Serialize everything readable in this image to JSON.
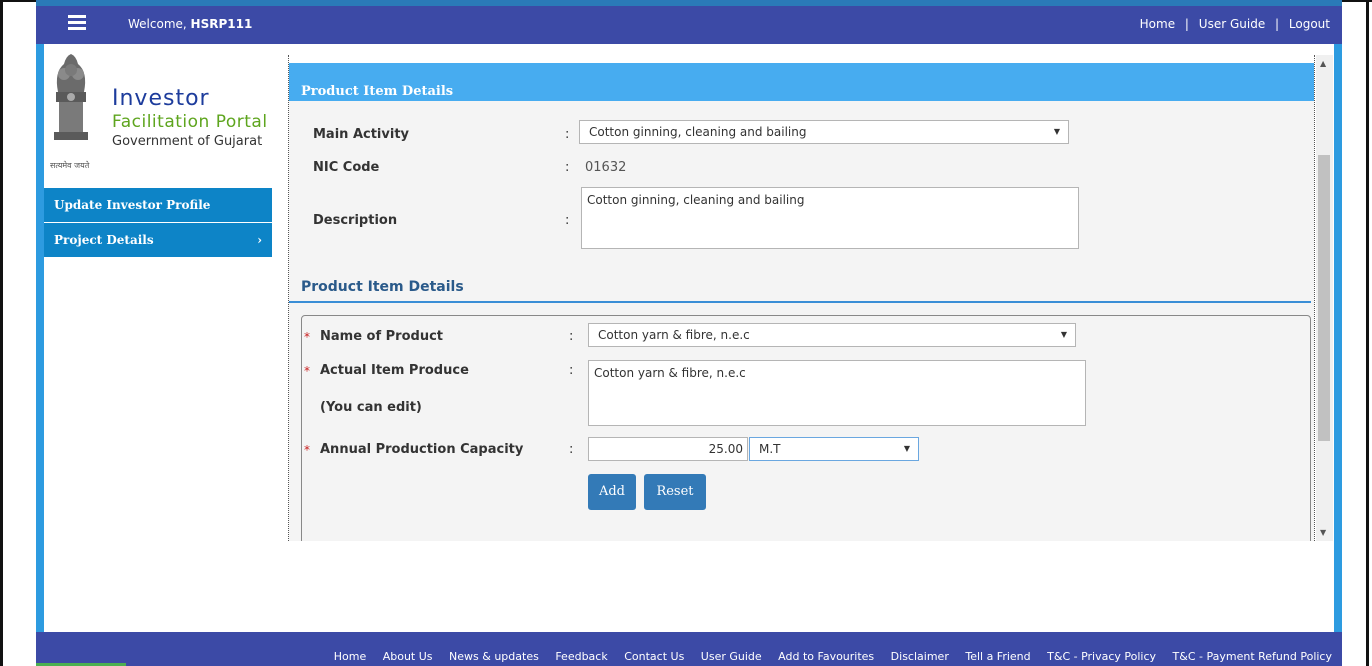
{
  "header": {
    "welcome_prefix": "Welcome,",
    "username": "HSRP111",
    "links": [
      "Home",
      "User Guide",
      "Logout"
    ],
    "separator": "|"
  },
  "logo": {
    "line1": "Investor",
    "line2": "Facilitation Portal",
    "line3": "Government of Gujarat",
    "motto": "सत्यमेव जयते"
  },
  "sidebar": {
    "items": [
      {
        "label": "Update Investor Profile"
      },
      {
        "label": "Project Details",
        "chevron": "›"
      }
    ]
  },
  "main": {
    "section_title": "Product Item Details",
    "main_activity": {
      "label": "Main Activity",
      "value": "Cotton ginning, cleaning and bailing"
    },
    "nic_code": {
      "label": "NIC Code",
      "value": "01632"
    },
    "description": {
      "label": "Description",
      "value": "Cotton ginning, cleaning and bailing"
    },
    "colon": ":",
    "subsection_title": "Product Item Details",
    "name_of_product": {
      "label": "Name of Product",
      "value": "Cotton yarn & fibre, n.e.c"
    },
    "actual_item_produce": {
      "label": "Actual Item Produce",
      "hint": "(You can edit)",
      "value": "Cotton yarn & fibre, n.e.c"
    },
    "annual_capacity": {
      "label": "Annual Production Capacity",
      "value": "25.00",
      "unit": "M.T"
    },
    "required_marker": "*",
    "add_button": "Add",
    "reset_button": "Reset"
  },
  "footer": {
    "links": [
      "Home",
      "About Us",
      "News & updates",
      "Feedback",
      "Contact Us",
      "User Guide",
      "Add to Favourites",
      "Disclaimer",
      "Tell a Friend",
      "T&C - Privacy Policy",
      "T&C - Payment Refund Policy"
    ]
  },
  "colors": {
    "header_bg": "#3c4aa6",
    "section_head_bg": "#47acf0",
    "sidebar_bg": "#0d84c7",
    "button_bg": "#337ab7",
    "required": "#c81e1e"
  }
}
